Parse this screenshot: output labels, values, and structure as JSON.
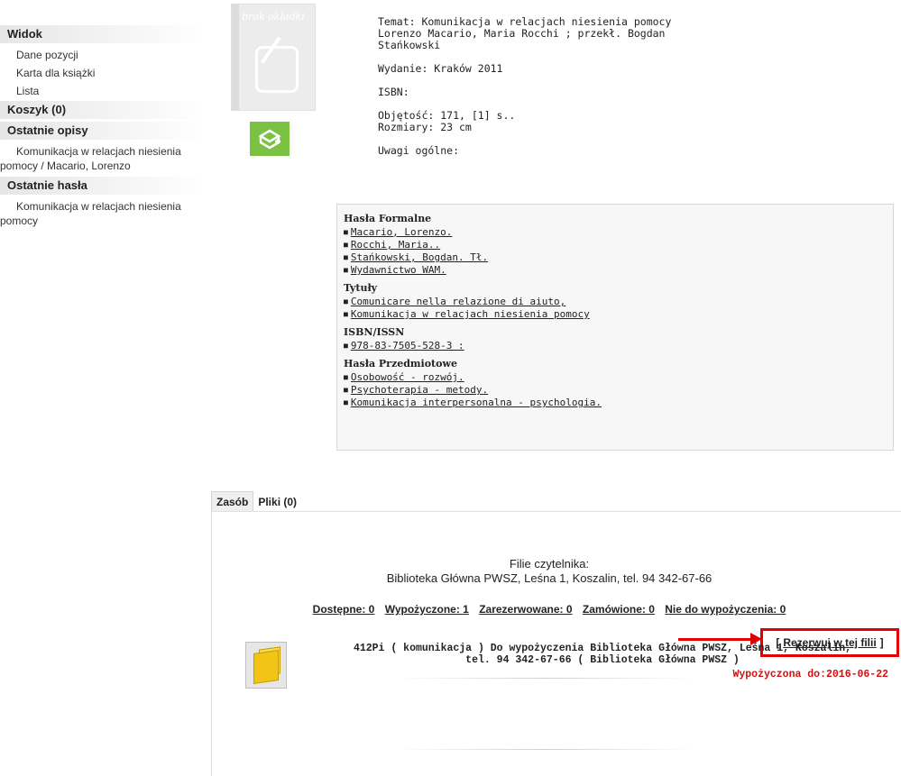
{
  "sidebar": {
    "view_header": "Widok",
    "view_items": [
      "Dane pozycji",
      "Karta dla książki",
      "Lista"
    ],
    "cart_header": "Koszyk (0)",
    "recent_desc_header": "Ostatnie opisy",
    "recent_desc_item": "Komunikacja w relacjach niesienia pomocy / Macario, Lorenzo",
    "recent_terms_header": "Ostatnie hasła",
    "recent_terms_item": "Komunikacja w relacjach niesienia pomocy"
  },
  "cover": {
    "no_cover_text": "brak okładki"
  },
  "meta": {
    "subject_line": "Temat: Komunikacja w relacjach niesienia pomocy",
    "authors_line": "Lorenzo Macario, Maria Rocchi ; przekł. Bogdan Stańkowski",
    "edition": "Wydanie: Kraków 2011",
    "isbn": "ISBN:",
    "volume": "Objętość: 171, [1] s..",
    "size": "Rozmiary: 23 cm",
    "notes": "Uwagi ogólne:"
  },
  "subjects": {
    "formal_title": "Hasła Formalne",
    "formal_items": [
      "Macario, Lorenzo.",
      "Rocchi, Maria..",
      "Stańkowski, Bogdan. Tł.",
      "Wydawnictwo WAM."
    ],
    "titles_title": "Tytuły",
    "titles_items": [
      "Comunicare nella relazione di aiuto,",
      "Komunikacja w relacjach niesienia pomocy"
    ],
    "isbn_title": "ISBN/ISSN",
    "isbn_items": [
      "978-83-7505-528-3 :"
    ],
    "subject_title": "Hasła Przedmiotowe",
    "subject_items": [
      "Osobowość - rozwój.",
      "Psychoterapia - metody.",
      "Komunikacja interpersonalna - psychologia."
    ]
  },
  "tabs": {
    "holdings": "Zasób",
    "files": "Pliki (0)"
  },
  "branch": {
    "label": "Filie czytelnika:",
    "name": "Biblioteka Główna PWSZ, Leśna 1, Koszalin, tel. 94 342-67-66"
  },
  "counts": {
    "available": "Dostępne: 0",
    "loaned": "Wypożyczone: 1",
    "reserved": "Zarezerwowane: 0",
    "ordered": "Zamówione: 0",
    "not_loanable": "Nie do wypożyczenia: 0"
  },
  "reserve": {
    "open": "[",
    "label": "Rezerwuj w tej filii",
    "close": "]"
  },
  "copy": {
    "line1": "412Pi ( komunikacja ) Do wypożyczenia Biblioteka Główna PWSZ, Leśna 1, Koszalin,",
    "line2": "tel. 94 342-67-66 ( Biblioteka Główna PWSZ )",
    "due": "Wypożyczona do:2016-06-22"
  }
}
